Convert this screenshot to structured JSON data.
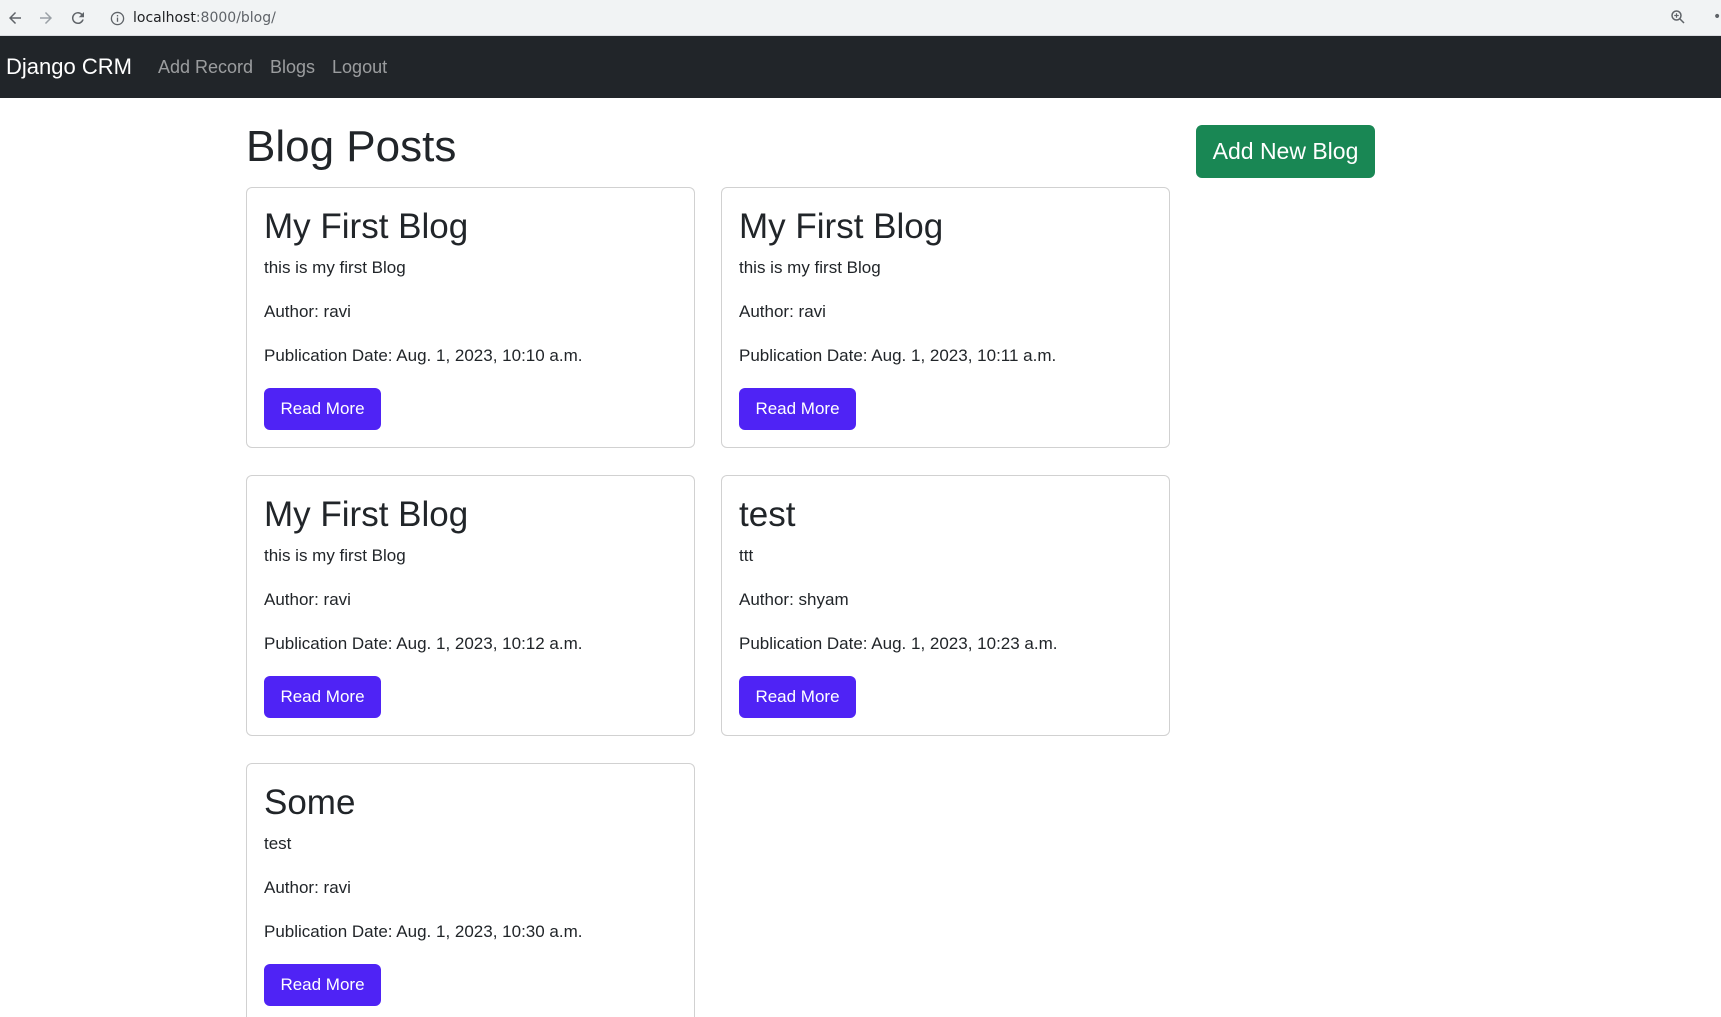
{
  "browser": {
    "url_host": "localhost",
    "url_rest": ":8000/blog/"
  },
  "navbar": {
    "brand": "Django CRM",
    "links": [
      "Add Record",
      "Blogs",
      "Logout"
    ]
  },
  "main": {
    "title": "Blog Posts",
    "add_button": "Add New Blog",
    "author_prefix": "Author: ",
    "date_prefix": "Publication Date: ",
    "read_more": "Read More",
    "posts": [
      {
        "title": "My First Blog",
        "body": "this is my first Blog",
        "author": "Author: ravi",
        "date": "Publication Date: Aug. 1, 2023, 10:10 a.m."
      },
      {
        "title": "My First Blog",
        "body": "this is my first Blog",
        "author": "Author: ravi",
        "date": "Publication Date: Aug. 1, 2023, 10:11 a.m."
      },
      {
        "title": "My First Blog",
        "body": "this is my first Blog",
        "author": "Author: ravi",
        "date": "Publication Date: Aug. 1, 2023, 10:12 a.m."
      },
      {
        "title": "test",
        "body": "ttt",
        "author": "Author: shyam",
        "date": "Publication Date: Aug. 1, 2023, 10:23 a.m."
      },
      {
        "title": "Some",
        "body": "test",
        "author": "Author: ravi",
        "date": "Publication Date: Aug. 1, 2023, 10:30 a.m."
      }
    ]
  },
  "colors": {
    "navbar_bg": "#212529",
    "success": "#198754",
    "primary_button": "#4f23f5"
  }
}
